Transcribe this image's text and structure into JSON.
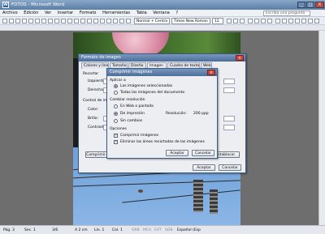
{
  "window": {
    "title": "FOTOS - Microsoft Word",
    "app_icon": "W",
    "minimize": "_",
    "maximize": "□",
    "close": "X"
  },
  "menu": {
    "items": [
      "Archivo",
      "Edición",
      "Ver",
      "Insertar",
      "Formato",
      "Herramientas",
      "Tabla",
      "Ventana",
      "?"
    ],
    "help_placeholder": "Escriba una pregunta"
  },
  "toolbar": {
    "style": "Normal + Centra",
    "font": "Times New Roman",
    "size": "12"
  },
  "format_dialog": {
    "title": "Formato de imagen",
    "tabs": [
      "Colores y líneas",
      "Tamaño",
      "Diseño",
      "Imagen",
      "Cuadro de texto",
      "Web"
    ],
    "crop_label": "Recortar",
    "left_label": "Izquierda:",
    "right_label": "Derecha:",
    "control_label": "Control de imagen",
    "color_label": "Color:",
    "brightness_label": "Brillo:",
    "contrast_label": "Contraste:",
    "compress_button": "Comprimir...",
    "reset_button": "Restablecer",
    "ok_button": "Aceptar",
    "cancel_button": "Cancelar"
  },
  "compress_dialog": {
    "title": "Comprimir imágenes",
    "apply_label": "Aplicar a",
    "apply_options": [
      "Las imágenes seleccionadas",
      "Todas las imágenes del documento"
    ],
    "resolution_label": "Cambiar resolución",
    "resolution_options": [
      "En Web o pantalla",
      "De impresión",
      "Sin cambios"
    ],
    "resolution_text": "Resolución:",
    "resolution_value": "200 ppp",
    "options_label": "Opciones",
    "checkboxes": [
      "Comprimir imágenes",
      "Eliminar las áreas recortadas de las imágenes"
    ],
    "ok_button": "Aceptar",
    "cancel_button": "Cancelar"
  },
  "status": {
    "page": "Pág. 3",
    "section": "Sec. 1",
    "pages": "3/6",
    "position": "A 2 cm",
    "line": "Lín. 1",
    "column": "Col. 1",
    "modes": [
      "GRB",
      "MCA",
      "EXT",
      "SOB"
    ],
    "language": "Español (Esp"
  }
}
